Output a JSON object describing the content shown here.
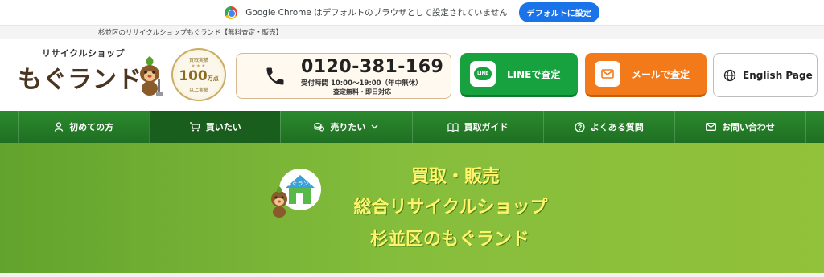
{
  "chrome_notice": {
    "message": "Google Chrome はデフォルトのブラウザとして設定されていません",
    "button": "デフォルトに設定"
  },
  "header": {
    "tagline": "杉並区のリサイクルショップもぐランド【無料査定・販売】",
    "logo_small": "リサイクルショップ",
    "logo_big": "もぐランド",
    "badge": {
      "top": "買取実績",
      "number": "100",
      "unit": "万点",
      "bottom": "以上実績"
    },
    "phone": {
      "number": "0120-381-169",
      "hours": "受付時間 10:00～19:00（年中無休）",
      "note": "査定無料・即日対応"
    },
    "cta": {
      "line": "LINEで査定",
      "line_icon_text": "LINE",
      "mail": "メールで査定",
      "english": "English Page"
    }
  },
  "nav": {
    "items": [
      {
        "label": "初めての方",
        "icon": "person-icon"
      },
      {
        "label": "買いたい",
        "icon": "cart-icon"
      },
      {
        "label": "売りたい",
        "icon": "coins-icon"
      },
      {
        "label": "買取ガイド",
        "icon": "book-icon"
      },
      {
        "label": "よくある質問",
        "icon": "question-icon"
      },
      {
        "label": "お問い合わせ",
        "icon": "mail-icon"
      }
    ]
  },
  "hero": {
    "line1": "買取・販売",
    "line2": "総合リサイクルショップ",
    "line3": "杉並区のもぐランド",
    "emblem_text": "もぐランド"
  },
  "colors": {
    "nav_green": "#2b8a2d",
    "line_green": "#18a13f",
    "mail_orange": "#f27a1a",
    "hero_text_yellow": "#fff46a",
    "chrome_blue": "#1a73e8"
  }
}
